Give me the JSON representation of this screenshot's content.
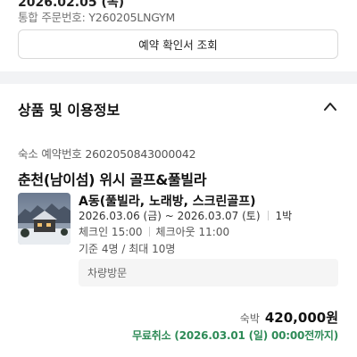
{
  "order": {
    "date_cut": "2026.02.05 (목)",
    "order_no_label": "통합 주문번호:",
    "order_no": "Y260205LNGYM",
    "confirm_button": "예약 확인서 조회"
  },
  "section": {
    "title": "상품 및 이용정보",
    "toggle_icon": "chevron-up-icon"
  },
  "reservation": {
    "label": "숙소 예약번호",
    "number": "2602050843000042",
    "property_name": "춘천(남이섬) 위시 골프&풀빌라",
    "room_name": "A동(풀빌라, 노래방, 스크린골프)",
    "date_range": "2026.03.06 (금) ~ 2026.03.07 (토)",
    "nights": "1박",
    "check_in": "체크인 15:00",
    "check_out": "체크아웃 11:00",
    "capacity": "기준 4명 / 최대 10명",
    "visit_method": "차량방문"
  },
  "price": {
    "label": "숙박",
    "amount": "420,000원"
  },
  "cancellation": {
    "text": "무료취소 (2026.03.01 (일) 00:00전까지)",
    "color": "#2e8b57"
  }
}
